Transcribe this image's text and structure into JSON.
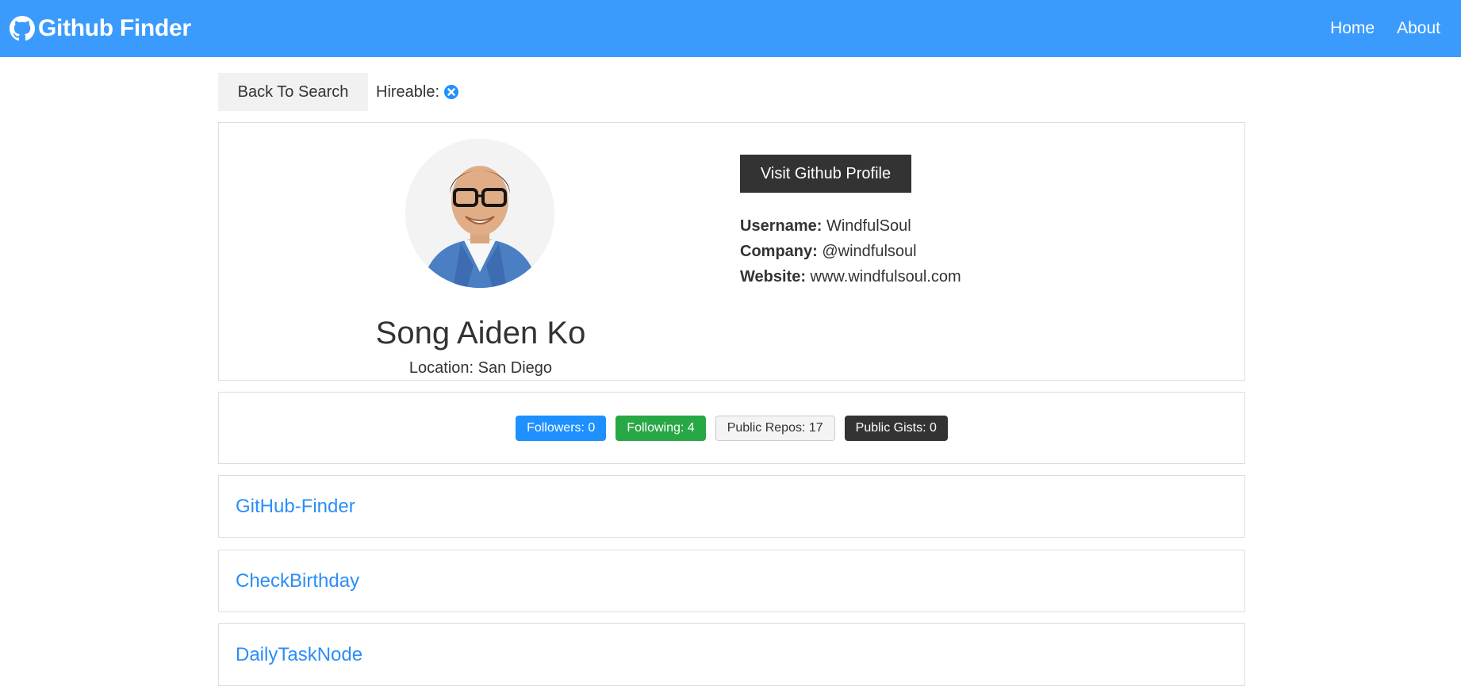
{
  "navbar": {
    "brand": "Github Finder",
    "links": [
      "Home",
      "About"
    ]
  },
  "actions": {
    "back_label": "Back To Search",
    "hireable_label": "Hireable:"
  },
  "profile": {
    "name": "Song Aiden Ko",
    "location": "Location: San Diego",
    "visit_label": "Visit Github Profile",
    "details": [
      {
        "label": "Username:",
        "value": "WindfulSoul"
      },
      {
        "label": "Company:",
        "value": "@windfulsoul"
      },
      {
        "label": "Website:",
        "value": "www.windfulsoul.com"
      }
    ]
  },
  "stats": {
    "followers": "Followers: 0",
    "following": "Following: 4",
    "public_repos": "Public Repos: 17",
    "public_gists": "Public Gists: 0"
  },
  "repos": [
    "GitHub-Finder",
    "CheckBirthday",
    "DailyTaskNode"
  ],
  "colors": {
    "navbar": "#3a9bfd",
    "primary": "#1e90ff",
    "success": "#28a745",
    "dark": "#333333",
    "repo_link": "#2b8ef5"
  },
  "icons": {
    "brand": "github-icon",
    "hireable": "times-circle-icon"
  }
}
